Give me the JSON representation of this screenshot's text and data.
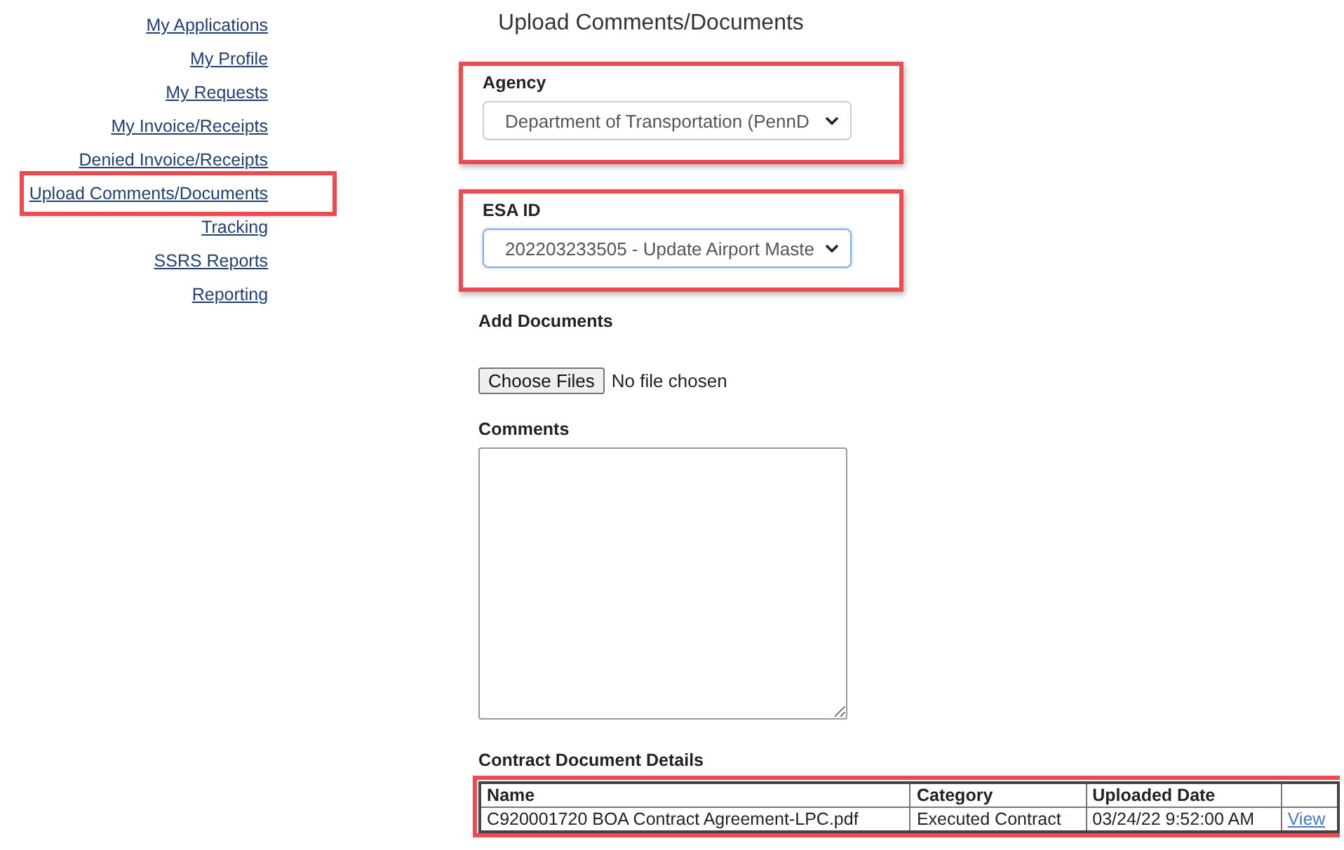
{
  "sidebar": {
    "items": [
      {
        "label": "My Applications",
        "selected": false
      },
      {
        "label": "My Profile",
        "selected": false
      },
      {
        "label": "My Requests",
        "selected": false
      },
      {
        "label": "My Invoice/Receipts",
        "selected": false
      },
      {
        "label": "Denied Invoice/Receipts",
        "selected": false
      },
      {
        "label": "Upload Comments/Documents",
        "selected": true
      },
      {
        "label": "Tracking",
        "selected": false
      },
      {
        "label": "SSRS Reports",
        "selected": false
      },
      {
        "label": "Reporting",
        "selected": false
      }
    ]
  },
  "title": "Upload Comments/Documents",
  "agency": {
    "label": "Agency",
    "value": "Department of Transportation (PennD",
    "focused": false,
    "highlighted": true
  },
  "esa_id": {
    "label": "ESA ID",
    "value": "202203233505 - Update Airport Maste",
    "focused": true,
    "highlighted": true
  },
  "add_documents": {
    "label": "Add Documents",
    "button": "Choose Files",
    "status": "No file chosen"
  },
  "comments": {
    "label": "Comments"
  },
  "contract_documents": {
    "title": "Contract Document Details",
    "highlighted": true,
    "columns": [
      "Name",
      "Category",
      "Uploaded Date",
      ""
    ],
    "rows": [
      {
        "name": "C920001720 BOA Contract Agreement-LPC.pdf",
        "category": "Executed Contract",
        "uploaded_date": "03/24/22 9:52:00 AM",
        "link": "View"
      }
    ]
  }
}
